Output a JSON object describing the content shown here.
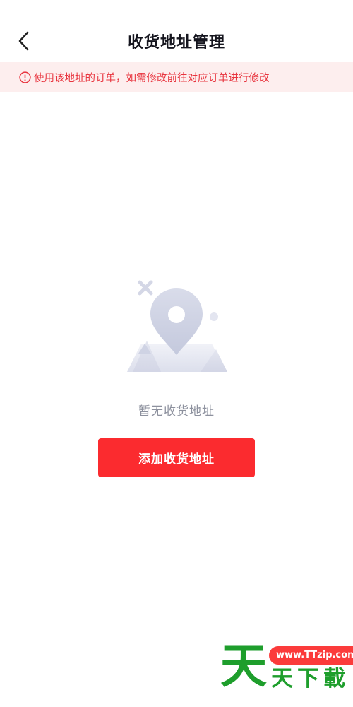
{
  "header": {
    "title": "收货地址管理",
    "back_icon": "chevron-left-icon"
  },
  "notice": {
    "icon": "info-circle-icon",
    "text": "使用该地址的订单，如需修改前往对应订单进行修改",
    "color": "#e8353f",
    "background": "#fdeeee"
  },
  "empty_state": {
    "illustration": "map-pin-illustration",
    "text": "暂无收货地址"
  },
  "add_button": {
    "label": "添加收货地址",
    "color": "#fb2b2f"
  },
  "watermark": {
    "logo_char": "天",
    "url": "www.TTzip.com",
    "chars": [
      "天",
      "下",
      "載"
    ],
    "color": "#1e9e2c"
  }
}
